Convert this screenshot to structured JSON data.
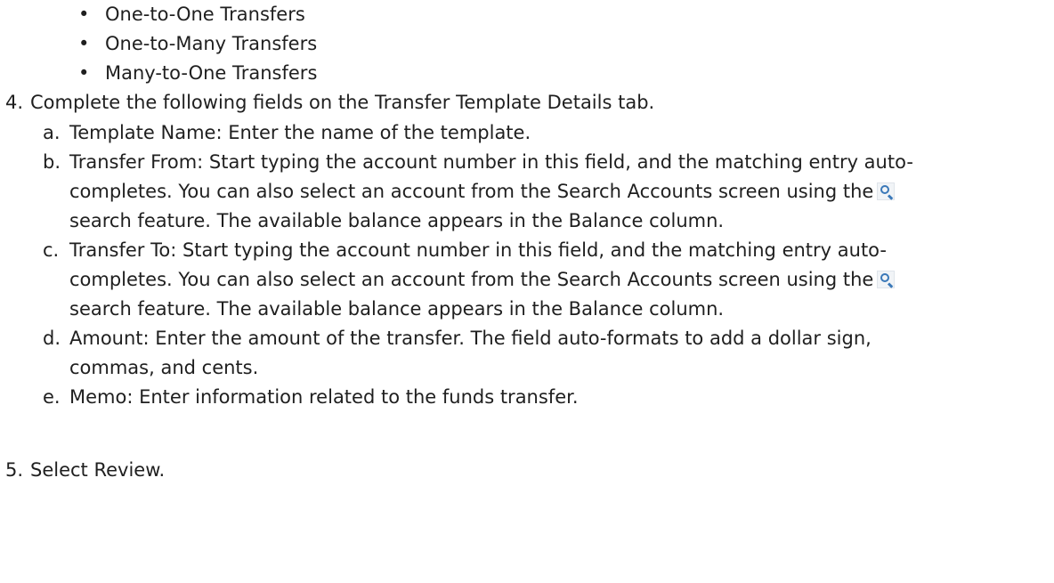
{
  "bullets": [
    {
      "mark": "•",
      "text": "One-to-One Transfers"
    },
    {
      "mark": "•",
      "text": "One-to-Many Transfers"
    },
    {
      "mark": "•",
      "text": "Many-to-One Transfers"
    }
  ],
  "step4": {
    "number": "4.",
    "text": "Complete the following fields on the Transfer Template Details tab."
  },
  "substeps": {
    "a": {
      "letter": "a.",
      "line1": "Template Name: Enter the name of the template."
    },
    "b": {
      "letter": "b.",
      "line1": "Transfer From: Start typing the account number in this field, and the matching entry auto-",
      "line2": "completes. You can also select an account from the Search Accounts screen using the",
      "line3": "search feature. The available balance appears in the Balance column."
    },
    "c": {
      "letter": "c.",
      "line1": "Transfer To: Start typing the account number in this field, and the matching entry auto-",
      "line2": "completes. You can also select an account from the Search Accounts screen using the",
      "line3": "search feature. The available balance appears in the Balance column."
    },
    "d": {
      "letter": "d.",
      "line1": "Amount: Enter the amount of the transfer. The field auto-formats to add a dollar sign,",
      "line2": "commas, and cents."
    },
    "e": {
      "letter": "e.",
      "line1": "Memo: Enter information related to the funds transfer."
    }
  },
  "step5": {
    "number": "5.",
    "text": "Select Review."
  },
  "icons": {
    "search": "search-icon"
  },
  "colors": {
    "text": "#1f1f1f",
    "icon_accent": "#3a78b8"
  }
}
